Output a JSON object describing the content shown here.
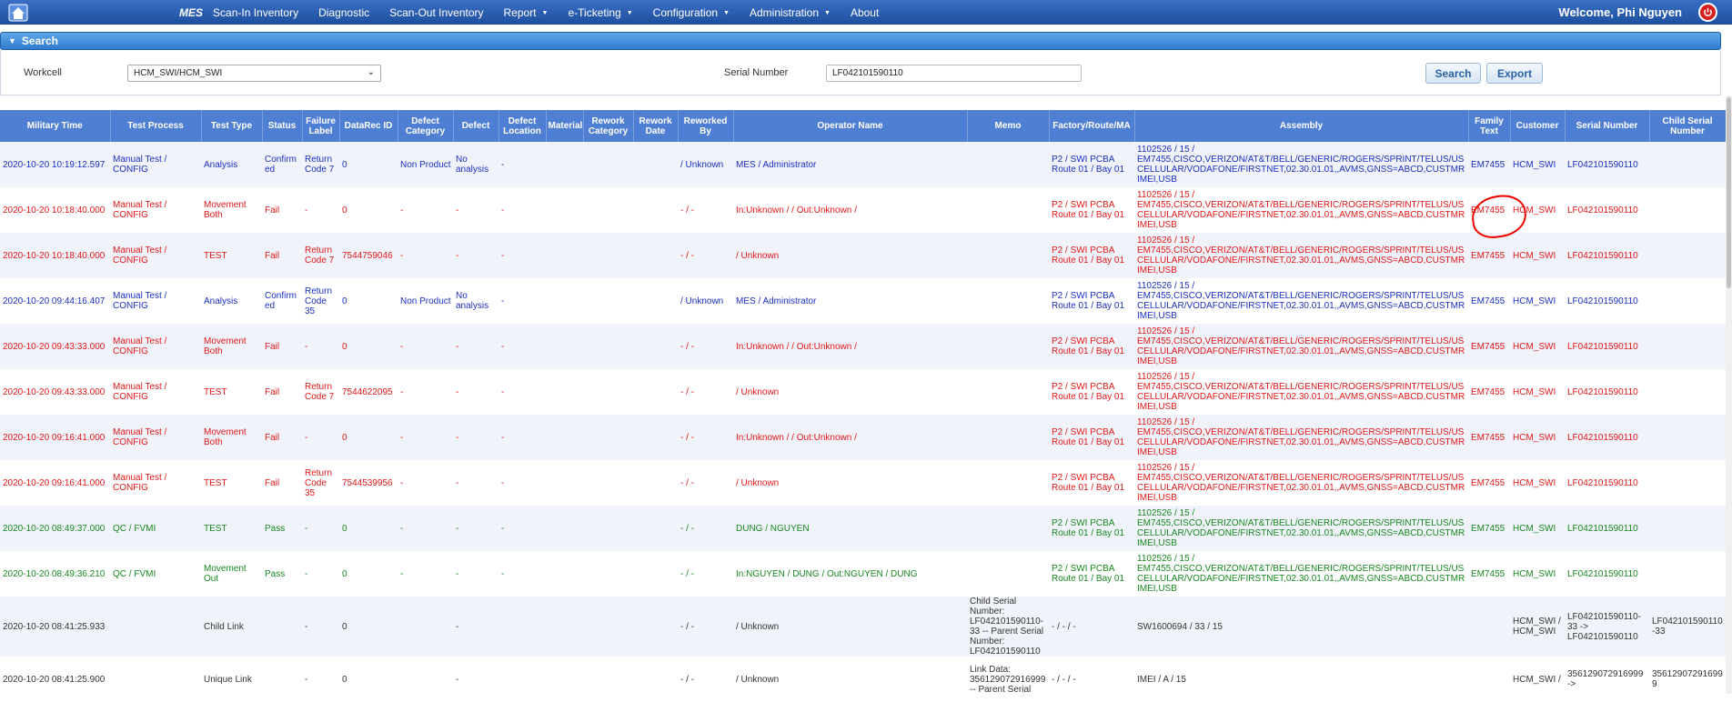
{
  "nav": {
    "brand": "MES",
    "items": [
      {
        "label": "Scan-In Inventory",
        "dropdown": false
      },
      {
        "label": "Diagnostic",
        "dropdown": false
      },
      {
        "label": "Scan-Out Inventory",
        "dropdown": false
      },
      {
        "label": "Report",
        "dropdown": true
      },
      {
        "label": "e-Ticketing",
        "dropdown": true
      },
      {
        "label": "Configuration",
        "dropdown": true
      },
      {
        "label": "Administration",
        "dropdown": true
      },
      {
        "label": "About",
        "dropdown": false
      }
    ],
    "welcome": "Welcome, Phi Nguyen",
    "icons": {
      "home": "home-icon",
      "logout": "power-icon"
    }
  },
  "search": {
    "title": "Search",
    "workcell_label": "Workcell",
    "workcell_value": "HCM_SWI/HCM_SWI",
    "serial_label": "Serial Number",
    "serial_value": "LF042101590110",
    "search_button": "Search",
    "export_button": "Export"
  },
  "table": {
    "headers": [
      "Military Time",
      "Test Process",
      "Test Type",
      "Status",
      "Failure Label",
      "DataRec ID",
      "Defect Category",
      "Defect",
      "Defect Location",
      "Material",
      "Rework Category",
      "Rework Date",
      "Reworked By",
      "Operator Name",
      "Memo",
      "Factory/Route/MA",
      "Assembly",
      "Family Text",
      "Customer",
      "Serial Number",
      "Child Serial Number"
    ],
    "rows": [
      {
        "color": "blue",
        "cells": [
          "2020-10-20 10:19:12.597",
          "Manual Test / CONFIG",
          "Analysis",
          "Confirmed",
          "Return Code 7",
          "0",
          "Non Product",
          "No analysis",
          "-",
          "",
          "",
          "",
          "/ Unknown",
          "MES / Administrator",
          "",
          "P2 / SWI PCBA Route 01 / Bay 01",
          "1102526 / 15 / EM7455,CISCO,VERIZON/AT&T/BELL/GENERIC/ROGERS/SPRINT/TELUS/US CELLULAR/VODAFONE/FIRSTNET,02.30.01.01,,AVMS,GNSS=ABCD,CUSTMR IMEI,USB",
          "EM7455",
          "HCM_SWI",
          "LF042101590110",
          ""
        ]
      },
      {
        "color": "red",
        "cells": [
          "2020-10-20 10:18:40.000",
          "Manual Test / CONFIG",
          "Movement Both",
          "Fail",
          "-",
          "0",
          "-",
          "-",
          "-",
          "",
          "",
          "",
          "- / -",
          "In:Unknown / / Out:Unknown /",
          "",
          "P2 / SWI PCBA Route 01 / Bay 01",
          "1102526 / 15 / EM7455,CISCO,VERIZON/AT&T/BELL/GENERIC/ROGERS/SPRINT/TELUS/US CELLULAR/VODAFONE/FIRSTNET,02.30.01.01,,AVMS,GNSS=ABCD,CUSTMR IMEI,USB",
          "EM7455",
          "HCM_SWI",
          "LF042101590110",
          ""
        ]
      },
      {
        "color": "red",
        "cells": [
          "2020-10-20 10:18:40.000",
          "Manual Test / CONFIG",
          "TEST",
          "Fail",
          "Return Code 7",
          "7544759046",
          "-",
          "-",
          "-",
          "",
          "",
          "",
          "- / -",
          "/ Unknown",
          "",
          "P2 / SWI PCBA Route 01 / Bay 01",
          "1102526 / 15 / EM7455,CISCO,VERIZON/AT&T/BELL/GENERIC/ROGERS/SPRINT/TELUS/US CELLULAR/VODAFONE/FIRSTNET,02.30.01.01,,AVMS,GNSS=ABCD,CUSTMR IMEI,USB",
          "EM7455",
          "HCM_SWI",
          "LF042101590110",
          ""
        ]
      },
      {
        "color": "blue",
        "cells": [
          "2020-10-20 09:44:16.407",
          "Manual Test / CONFIG",
          "Analysis",
          "Confirmed",
          "Return Code 35",
          "0",
          "Non Product",
          "No analysis",
          "-",
          "",
          "",
          "",
          "/ Unknown",
          "MES / Administrator",
          "",
          "P2 / SWI PCBA Route 01 / Bay 01",
          "1102526 / 15 / EM7455,CISCO,VERIZON/AT&T/BELL/GENERIC/ROGERS/SPRINT/TELUS/US CELLULAR/VODAFONE/FIRSTNET,02.30.01.01,,AVMS,GNSS=ABCD,CUSTMR IMEI,USB",
          "EM7455",
          "HCM_SWI",
          "LF042101590110",
          ""
        ]
      },
      {
        "color": "red",
        "cells": [
          "2020-10-20 09:43:33.000",
          "Manual Test / CONFIG",
          "Movement Both",
          "Fail",
          "-",
          "0",
          "-",
          "-",
          "-",
          "",
          "",
          "",
          "- / -",
          "In:Unknown / / Out:Unknown /",
          "",
          "P2 / SWI PCBA Route 01 / Bay 01",
          "1102526 / 15 / EM7455,CISCO,VERIZON/AT&T/BELL/GENERIC/ROGERS/SPRINT/TELUS/US CELLULAR/VODAFONE/FIRSTNET,02.30.01.01,,AVMS,GNSS=ABCD,CUSTMR IMEI,USB",
          "EM7455",
          "HCM_SWI",
          "LF042101590110",
          ""
        ]
      },
      {
        "color": "red",
        "cells": [
          "2020-10-20 09:43:33.000",
          "Manual Test / CONFIG",
          "TEST",
          "Fail",
          "Return Code 7",
          "7544622095",
          "-",
          "-",
          "-",
          "",
          "",
          "",
          "- / -",
          "/ Unknown",
          "",
          "P2 / SWI PCBA Route 01 / Bay 01",
          "1102526 / 15 / EM7455,CISCO,VERIZON/AT&T/BELL/GENERIC/ROGERS/SPRINT/TELUS/US CELLULAR/VODAFONE/FIRSTNET,02.30.01.01,,AVMS,GNSS=ABCD,CUSTMR IMEI,USB",
          "EM7455",
          "HCM_SWI",
          "LF042101590110",
          ""
        ]
      },
      {
        "color": "red",
        "cells": [
          "2020-10-20 09:16:41.000",
          "Manual Test / CONFIG",
          "Movement Both",
          "Fail",
          "-",
          "0",
          "-",
          "-",
          "-",
          "",
          "",
          "",
          "- / -",
          "In:Unknown / / Out:Unknown /",
          "",
          "P2 / SWI PCBA Route 01 / Bay 01",
          "1102526 / 15 / EM7455,CISCO,VERIZON/AT&T/BELL/GENERIC/ROGERS/SPRINT/TELUS/US CELLULAR/VODAFONE/FIRSTNET,02.30.01.01,,AVMS,GNSS=ABCD,CUSTMR IMEI,USB",
          "EM7455",
          "HCM_SWI",
          "LF042101590110",
          ""
        ]
      },
      {
        "color": "red",
        "cells": [
          "2020-10-20 09:16:41.000",
          "Manual Test / CONFIG",
          "TEST",
          "Fail",
          "Return Code 35",
          "7544539956",
          "-",
          "-",
          "-",
          "",
          "",
          "",
          "- / -",
          "/ Unknown",
          "",
          "P2 / SWI PCBA Route 01 / Bay 01",
          "1102526 / 15 / EM7455,CISCO,VERIZON/AT&T/BELL/GENERIC/ROGERS/SPRINT/TELUS/US CELLULAR/VODAFONE/FIRSTNET,02.30.01.01,,AVMS,GNSS=ABCD,CUSTMR IMEI,USB",
          "EM7455",
          "HCM_SWI",
          "LF042101590110",
          ""
        ]
      },
      {
        "color": "green",
        "cells": [
          "2020-10-20 08:49:37.000",
          "QC / FVMI",
          "TEST",
          "Pass",
          "-",
          "0",
          "-",
          "-",
          "-",
          "",
          "",
          "",
          "- / -",
          "DUNG / NGUYEN",
          "",
          "P2 / SWI PCBA Route 01 / Bay 01",
          "1102526 / 15 / EM7455,CISCO,VERIZON/AT&T/BELL/GENERIC/ROGERS/SPRINT/TELUS/US CELLULAR/VODAFONE/FIRSTNET,02.30.01.01,,AVMS,GNSS=ABCD,CUSTMR IMEI,USB",
          "EM7455",
          "HCM_SWI",
          "LF042101590110",
          ""
        ]
      },
      {
        "color": "green",
        "cells": [
          "2020-10-20 08:49:36.210",
          "QC / FVMI",
          "Movement Out",
          "Pass",
          "-",
          "0",
          "-",
          "-",
          "-",
          "",
          "",
          "",
          "- / -",
          "In:NGUYEN / DUNG / Out:NGUYEN / DUNG",
          "",
          "P2 / SWI PCBA Route 01 / Bay 01",
          "1102526 / 15 / EM7455,CISCO,VERIZON/AT&T/BELL/GENERIC/ROGERS/SPRINT/TELUS/US CELLULAR/VODAFONE/FIRSTNET,02.30.01.01,,AVMS,GNSS=ABCD,CUSTMR IMEI,USB",
          "EM7455",
          "HCM_SWI",
          "LF042101590110",
          ""
        ]
      },
      {
        "color": "dark",
        "cells": [
          "2020-10-20 08:41:25.933",
          "",
          "Child Link",
          "",
          "-",
          "0",
          "",
          "-",
          "",
          "",
          "",
          "",
          "- / -",
          "/ Unknown",
          "Child Serial Number: LF042101590110-33 -- Parent Serial Number: LF042101590110",
          "- / - / -",
          "SW1600694 / 33 / 15",
          "",
          "HCM_SWI / HCM_SWI",
          "LF042101590110-33 -> LF042101590110",
          "LF042101590110-33"
        ]
      },
      {
        "color": "dark",
        "cells": [
          "2020-10-20 08:41:25.900",
          "",
          "Unique Link",
          "",
          "-",
          "0",
          "",
          "-",
          "",
          "",
          "",
          "",
          "- / -",
          "/ Unknown",
          "Link Data: 356129072916999 -- Parent Serial",
          "- / - / -",
          "IMEI / A / 15",
          "",
          "HCM_SWI /",
          "356129072916999 ->",
          "356129072916999"
        ]
      }
    ]
  }
}
